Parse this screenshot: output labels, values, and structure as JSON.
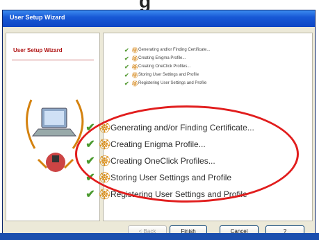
{
  "window": {
    "title": "User Setup Wizard"
  },
  "sidebar": {
    "title": "User Setup Wizard"
  },
  "steps": [
    {
      "label": "Generating and/or Finding Certificate...",
      "status": "done"
    },
    {
      "label": "Creating Enigma Profile...",
      "status": "done"
    },
    {
      "label": "Creating OneClick Profiles...",
      "status": "done"
    },
    {
      "label": "Storing User Settings and Profile",
      "status": "done"
    },
    {
      "label": "Registering User Settings and Profile",
      "status": "done"
    }
  ],
  "buttons": {
    "back": "< Back",
    "finish": "Finish",
    "cancel": "Cancel",
    "help": "?"
  },
  "colors": {
    "highlight_ellipse": "#e11d1d",
    "check": "#4a9a2e",
    "certificate_icon": "#d98a10",
    "titlebar": "#1859d6"
  }
}
